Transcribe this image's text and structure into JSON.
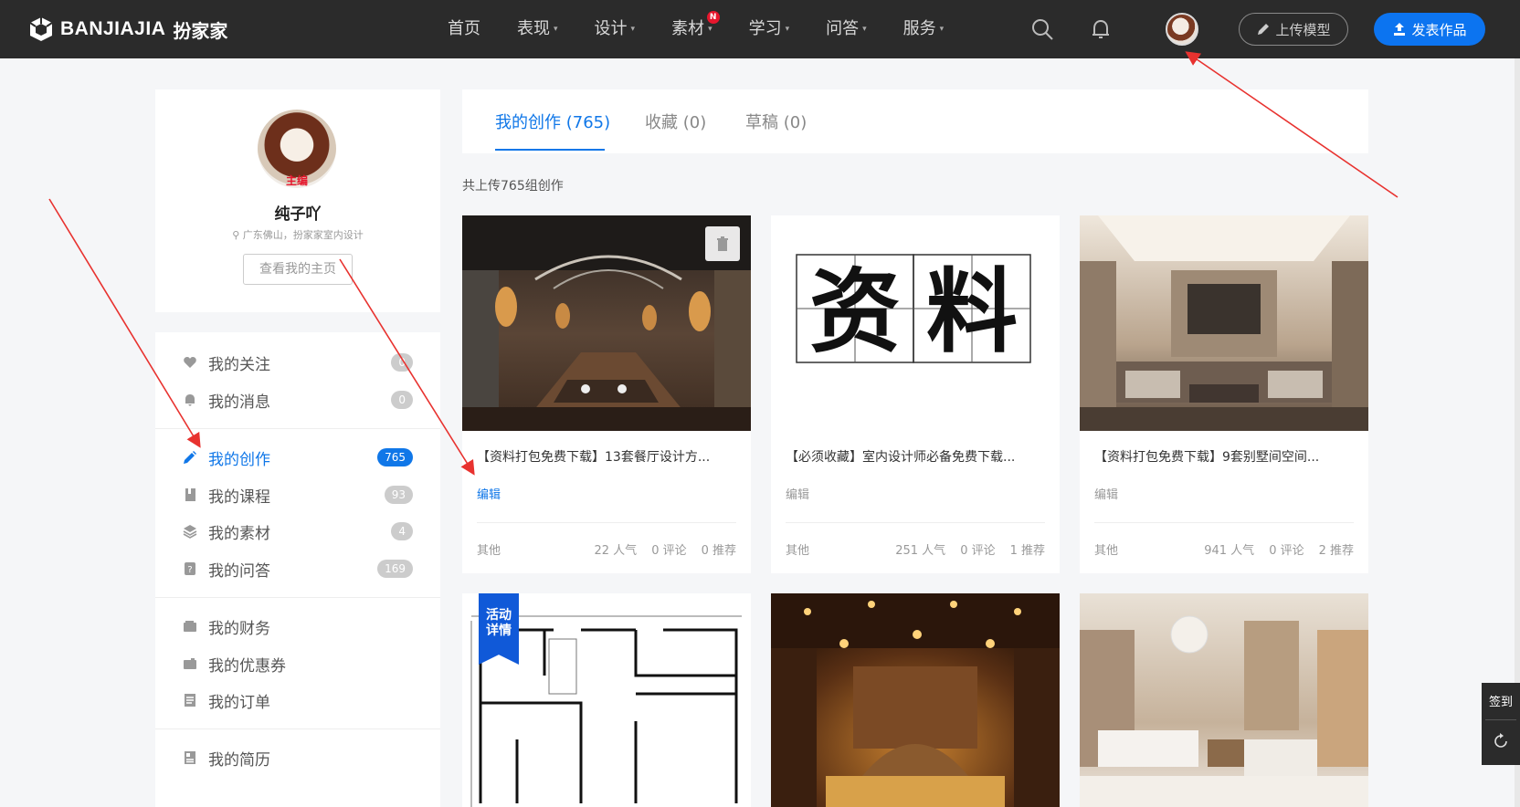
{
  "header": {
    "logo_text": "BANJIAJIA",
    "logo_cn": "扮家家",
    "nav": [
      {
        "label": "首页",
        "caret": false,
        "badge": ""
      },
      {
        "label": "表现",
        "caret": true,
        "badge": ""
      },
      {
        "label": "设计",
        "caret": true,
        "badge": ""
      },
      {
        "label": "素材",
        "caret": true,
        "badge": "N"
      },
      {
        "label": "学习",
        "caret": true,
        "badge": ""
      },
      {
        "label": "问答",
        "caret": true,
        "badge": ""
      },
      {
        "label": "服务",
        "caret": true,
        "badge": ""
      }
    ],
    "upload_label": "上传模型",
    "publish_label": "发表作品"
  },
  "profile": {
    "role": "主编",
    "name": "纯子吖",
    "location": "广东佛山，扮家家室内设计",
    "home_button": "查看我的主页"
  },
  "menu": {
    "items": [
      {
        "label": "我的关注",
        "count": "0",
        "icon": "heart-icon"
      },
      {
        "label": "我的消息",
        "count": "0",
        "icon": "bell-icon"
      },
      {
        "label": "我的创作",
        "count": "765",
        "icon": "pencil-icon",
        "active": true
      },
      {
        "label": "我的课程",
        "count": "93",
        "icon": "book-icon"
      },
      {
        "label": "我的素材",
        "count": "4",
        "icon": "layers-icon"
      },
      {
        "label": "我的问答",
        "count": "169",
        "icon": "question-icon"
      },
      {
        "label": "我的财务",
        "count": "",
        "icon": "wallet-icon"
      },
      {
        "label": "我的优惠券",
        "count": "",
        "icon": "coupon-icon"
      },
      {
        "label": "我的订单",
        "count": "",
        "icon": "order-icon"
      },
      {
        "label": "我的简历",
        "count": "",
        "icon": "resume-icon"
      }
    ]
  },
  "tabs": [
    {
      "label": "我的创作 (765)",
      "active": true
    },
    {
      "label": "收藏 (0)",
      "active": false
    },
    {
      "label": "草稿 (0)",
      "active": false
    }
  ],
  "total_text": "共上传765组创作",
  "cards": [
    {
      "title": "【资料打包免费下载】13套餐厅设计方...",
      "edit": "编辑",
      "category": "其他",
      "views": "22 人气",
      "comments": "0 评论",
      "recommends": "0 推荐"
    },
    {
      "title": "【必须收藏】室内设计师必备免费下载...",
      "edit": "编辑",
      "category": "其他",
      "views": "251 人气",
      "comments": "0 评论",
      "recommends": "1 推荐",
      "thumb_chars": [
        "资",
        "料"
      ]
    },
    {
      "title": "【资料打包免费下载】9套别墅间空间...",
      "edit": "编辑",
      "category": "其他",
      "views": "941 人气",
      "comments": "0 评论",
      "recommends": "2 推荐"
    },
    {
      "ribbon": "活动详情"
    },
    {},
    {}
  ],
  "float": {
    "sign_label": "签到"
  },
  "colors": {
    "accent": "#1077e8",
    "nav_bg": "#2b2b2b",
    "annotation": "#e8322f"
  }
}
